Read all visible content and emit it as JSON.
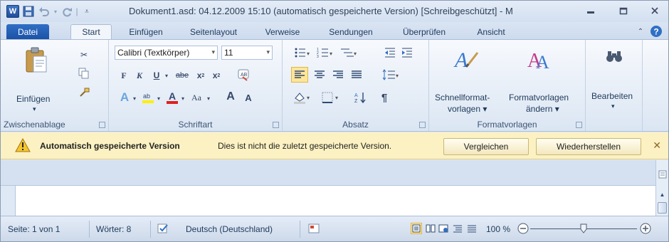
{
  "window": {
    "title": "Dokument1.asd: 04.12.2009 15:10 (automatisch gespeicherte Version) [Schreibgeschützt] - M"
  },
  "tabs": [
    {
      "label": "Datei"
    },
    {
      "label": "Start"
    },
    {
      "label": "Einfügen"
    },
    {
      "label": "Seitenlayout"
    },
    {
      "label": "Verweise"
    },
    {
      "label": "Sendungen"
    },
    {
      "label": "Überprüfen"
    },
    {
      "label": "Ansicht"
    }
  ],
  "ribbon": {
    "clipboard": {
      "paste_label": "Einfügen",
      "group_label": "Zwischenablage"
    },
    "font": {
      "font_name": "Calibri (Textkörper)",
      "font_size": "11",
      "group_label": "Schriftart",
      "bold": "F",
      "italic": "K",
      "underline": "U",
      "strike": "abe",
      "grow": "A",
      "shrink": "A",
      "case": "Aa"
    },
    "paragraph": {
      "group_label": "Absatz",
      "pilcrow": "¶"
    },
    "styles": {
      "quick_styles_label_1": "Schnellformat-",
      "quick_styles_label_2": "vorlagen ▾",
      "change_styles_label_1": "Formatvorlagen",
      "change_styles_label_2": "ändern ▾",
      "group_label": "Formatvorlagen"
    },
    "editing": {
      "label": "Bearbeiten"
    }
  },
  "infobar": {
    "title": "Automatisch gespeicherte Version",
    "message": "Dies ist nicht die zuletzt gespeicherte Version.",
    "compare_label": "Vergleichen",
    "restore_label": "Wiederherstellen",
    "close": "✕"
  },
  "statusbar": {
    "page": "Seite: 1 von 1",
    "words": "Wörter: 8",
    "language": "Deutsch (Deutschland)",
    "zoom": "100 %",
    "zoom_level": 100
  },
  "colors": {
    "file_tab": "#2f6fc5",
    "infobar_bg": "#fcf1c2",
    "ribbon_bg": "#dbe6f3"
  }
}
